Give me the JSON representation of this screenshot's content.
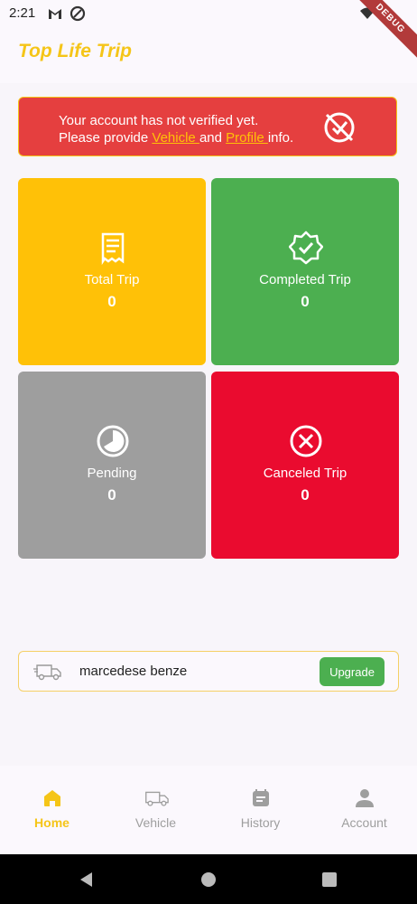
{
  "status_bar": {
    "time": "2:21"
  },
  "debug_banner": "DEBUG",
  "app": {
    "title": "Top Life Trip"
  },
  "alert": {
    "line1": "Your account has not verified yet.",
    "line2_prefix": "Please provide ",
    "vehicle_link": "Vehicle ",
    "middle": "and ",
    "profile_link": "Profile ",
    "suffix": "info."
  },
  "cards": [
    {
      "label": "Total Trip",
      "value": "0",
      "color": "#ffc107",
      "icon": "receipt-icon"
    },
    {
      "label": "Completed Trip",
      "value": "0",
      "color": "#4caf50",
      "icon": "verified-badge-icon"
    },
    {
      "label": "Pending",
      "value": "0",
      "color": "#9e9e9e",
      "icon": "pie-clock-icon"
    },
    {
      "label": "Canceled Trip",
      "value": "0",
      "color": "#ea0b2f",
      "icon": "cancel-circle-icon"
    }
  ],
  "vehicle": {
    "name": "marcedese benze",
    "upgrade_label": "Upgrade"
  },
  "bottom_nav": [
    {
      "label": "Home",
      "icon": "home-icon",
      "active": true
    },
    {
      "label": "Vehicle",
      "icon": "truck-icon",
      "active": false
    },
    {
      "label": "History",
      "icon": "history-icon",
      "active": false
    },
    {
      "label": "Account",
      "icon": "person-icon",
      "active": false
    }
  ],
  "colors": {
    "accent": "#f5c518",
    "alert_bg": "#e53f3f",
    "upgrade": "#4caf50"
  }
}
